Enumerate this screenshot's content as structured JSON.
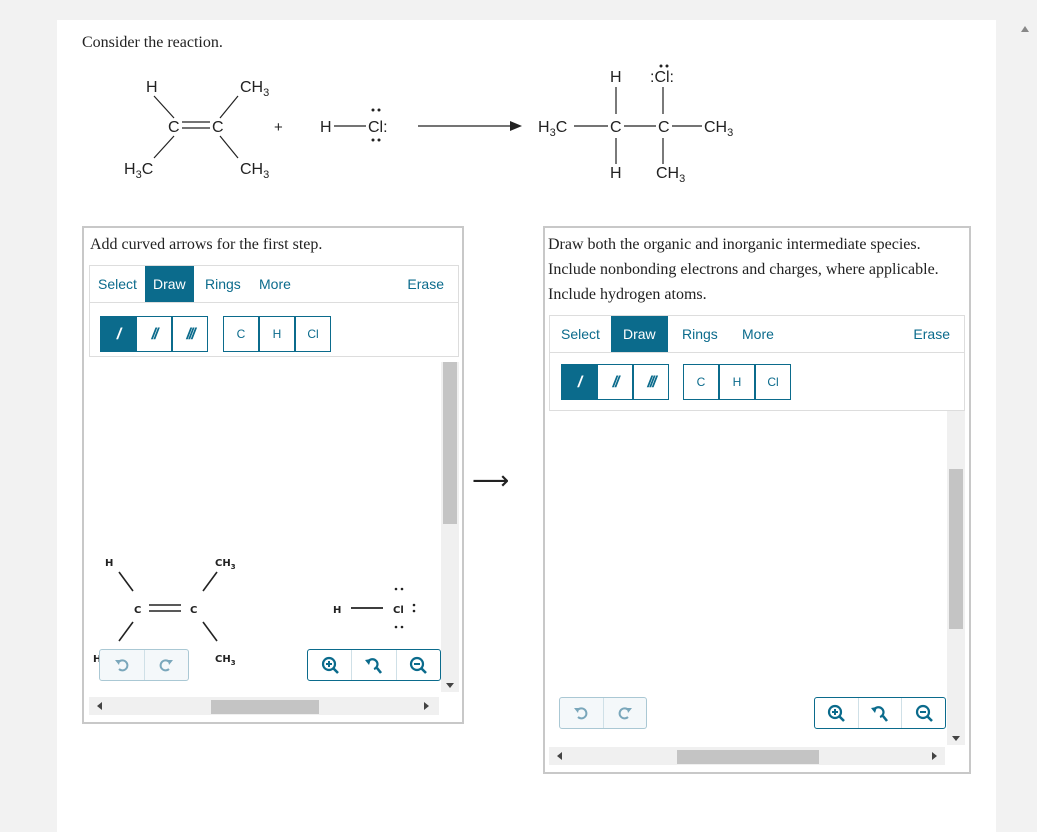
{
  "prompt": "Consider the reaction.",
  "reaction": {
    "reactant1": {
      "top_left": "H",
      "top_right": "CH3",
      "center": "C═C",
      "bottom_left": "H3C",
      "bottom_right": "CH3"
    },
    "plus": "+",
    "reactant2": {
      "h": "H",
      "cl": "Cl"
    },
    "product": {
      "left": "H3C",
      "c1": "C",
      "c2": "C",
      "right": "CH3",
      "h_top": "H",
      "cl_top": "Cl",
      "h_bottom": "H",
      "ch3_bottom": "CH3"
    }
  },
  "left_panel": {
    "instruction": "Add curved arrows for the first step.",
    "tabs": [
      "Select",
      "Draw",
      "Rings",
      "More"
    ],
    "active_tab": "Draw",
    "erase": "Erase",
    "atoms": [
      "C",
      "H",
      "Cl"
    ],
    "canvas": {
      "h_top": "H",
      "ch3_top": "CH3",
      "c_left": "C",
      "c_right": "C",
      "ch3_bottom": "CH3",
      "h_cut": "H",
      "hcl_h": "H",
      "hcl_cl": "Cl"
    }
  },
  "step_arrow": "⟶",
  "right_panel": {
    "instruction": "Draw both the organic and inorganic intermediate species. Include nonbonding electrons and charges, where applicable. Include hydrogen atoms.",
    "tabs": [
      "Select",
      "Draw",
      "Rings",
      "More"
    ],
    "active_tab": "Draw",
    "erase": "Erase",
    "atoms": [
      "C",
      "H",
      "Cl"
    ]
  },
  "colors": {
    "accent": "#0b6b8c",
    "panel_border": "#c8c8c8",
    "scroll_thumb": "#c4c4c4"
  },
  "icons": [
    "undo-icon",
    "redo-icon",
    "zoom-in-icon",
    "zoom-reset-icon",
    "zoom-out-icon"
  ]
}
